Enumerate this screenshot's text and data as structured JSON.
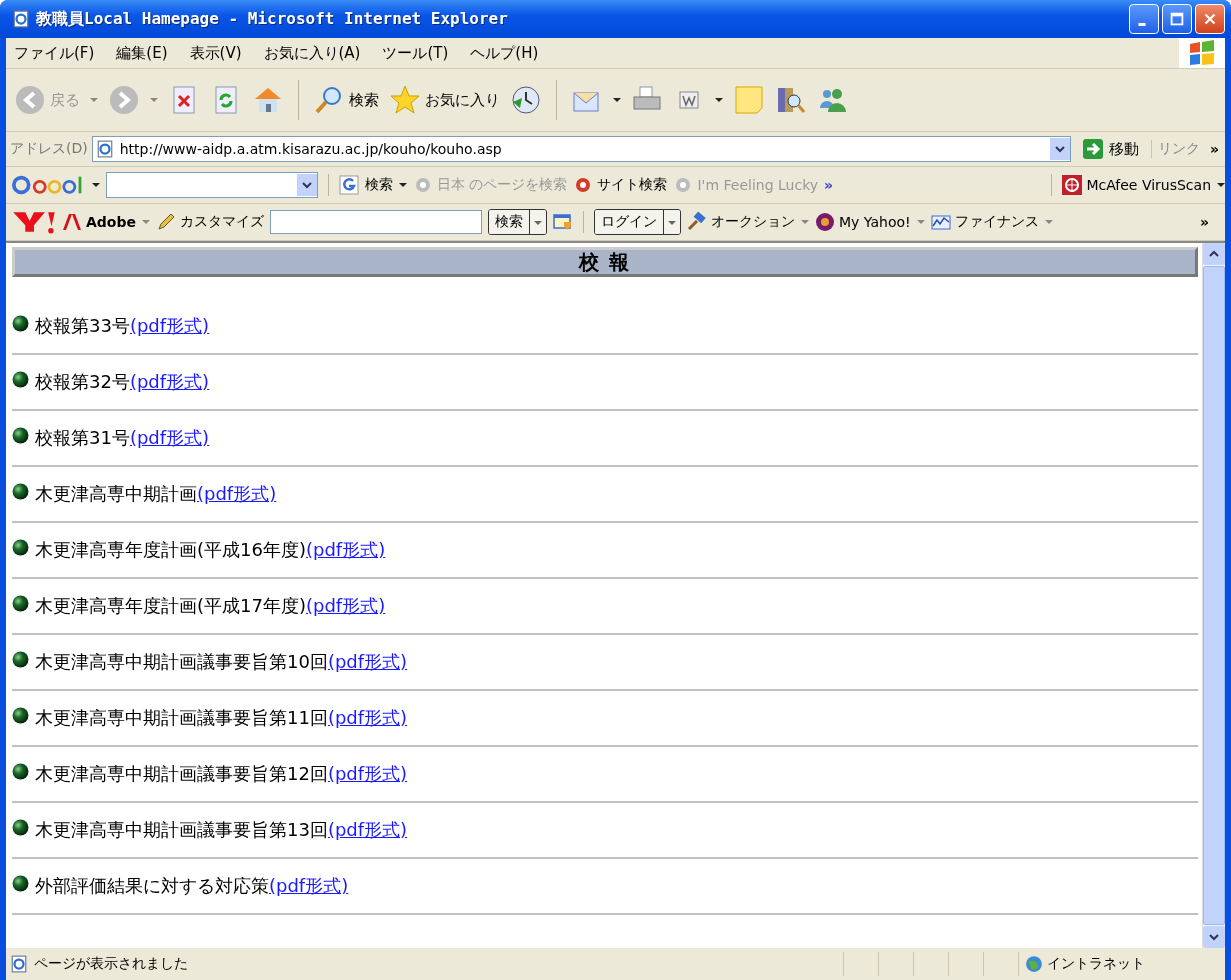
{
  "window": {
    "title": "教職員Local Hamepage - Microsoft Internet Explorer"
  },
  "menu_bar": [
    "ファイル(F)",
    "編集(E)",
    "表示(V)",
    "お気に入り(A)",
    "ツール(T)",
    "ヘルプ(H)"
  ],
  "toolbar": {
    "back": {
      "label": "戻る",
      "disabled": true
    },
    "forward": {
      "disabled": true
    },
    "search": "検索",
    "favorites": "お気に入り"
  },
  "address_bar": {
    "label": "アドレス(D)",
    "url": "http://www-aidp.a.atm.kisarazu.ac.jp/kouho/kouho.asp",
    "go": "移動",
    "links": "リンク",
    "more": "»"
  },
  "google_toolbar": {
    "search": "検索",
    "items": [
      {
        "label": "日本 のページを検索",
        "disabled": true
      },
      {
        "label": "サイト検索",
        "disabled": false
      },
      {
        "label": "I'm Feeling Lucky",
        "disabled": true
      }
    ],
    "more": "»",
    "mcafee": "McAfee VirusScan"
  },
  "yahoo_toolbar": {
    "adobe": "Adobe",
    "customize": "カスタマイズ",
    "search": "検索",
    "login": "ログイン",
    "auction": "オークション",
    "my_yahoo": "My Yahoo!",
    "finance": "ファイナンス",
    "more": "»"
  },
  "page": {
    "heading": "校 報",
    "items": [
      {
        "text": "校報第33号",
        "link": "(pdf形式)"
      },
      {
        "text": "校報第32号",
        "link": "(pdf形式)"
      },
      {
        "text": "校報第31号",
        "link": "(pdf形式)"
      },
      {
        "text": "木更津高専中期計画",
        "link": "(pdf形式)"
      },
      {
        "text": "木更津高専年度計画(平成16年度)",
        "link": "(pdf形式)"
      },
      {
        "text": "木更津高専年度計画(平成17年度)",
        "link": "(pdf形式)"
      },
      {
        "text": "木更津高専中期計画議事要旨第10回",
        "link": "(pdf形式)"
      },
      {
        "text": "木更津高専中期計画議事要旨第11回",
        "link": "(pdf形式)"
      },
      {
        "text": "木更津高専中期計画議事要旨第12回",
        "link": "(pdf形式)"
      },
      {
        "text": "木更津高専中期計画議事要旨第13回",
        "link": "(pdf形式)"
      },
      {
        "text": "外部評価結果に対する対応策",
        "link": "(pdf形式)"
      }
    ]
  },
  "status_bar": {
    "message": "ページが表示されました",
    "zone": "イントラネット"
  }
}
